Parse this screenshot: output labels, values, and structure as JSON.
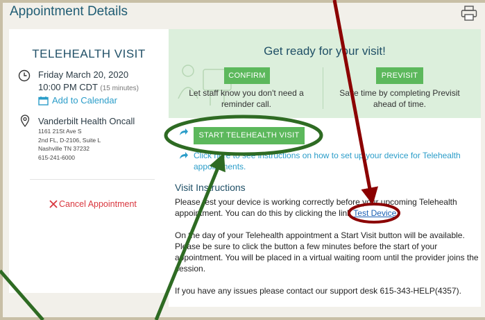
{
  "header": {
    "title": "Appointment Details",
    "print_icon": "printer-icon"
  },
  "appointment": {
    "type": "TELEHEALTH VISIT",
    "date": "Friday March 20, 2020",
    "time": "10:00 PM CDT",
    "duration": "(15 minutes)",
    "add_calendar": "Add to Calendar",
    "location_name": "Vanderbilt Health Oncall",
    "address": [
      "1161 21St Ave S",
      "2nd FL, D-2106, Suite L",
      "Nashville TN 37232",
      "615-241-6000"
    ],
    "cancel": "Cancel Appointment"
  },
  "ready": {
    "title": "Get ready for your visit!",
    "confirm_label": "CONFIRM",
    "confirm_desc": [
      "Let staff know you don't need a",
      "reminder call."
    ],
    "previsit_label": "PREVISIT",
    "previsit_desc": [
      "Save time by completing Previsit",
      "ahead of time."
    ]
  },
  "actions": {
    "start_label": "START TELEHEALTH VISIT",
    "instructions_link": [
      "Click here to see instructions on how to set up your device for Telehealth",
      "appointments."
    ]
  },
  "instructions": {
    "heading": "Visit Instructions",
    "p1": [
      "Please test your device is working correctly before your upcoming Telehealth",
      "appointment.  You can do this by clicking the link"
    ],
    "test_link": "Test Device",
    "p2": [
      "On the day of your Telehealth appointment a Start Visit button will be available.",
      "Please be sure to click the button a few minutes before the start of your",
      "appointment.  You will be placed in a virtual waiting room until the provider joins the",
      "session."
    ],
    "p3": "If you have any issues please contact our support desk 615-343-HELP(4357)."
  },
  "colors": {
    "accent_green": "#5cb85c",
    "arrow_red": "#8b0000",
    "arrow_green": "#2e6b23",
    "cancel_red": "#d9363e",
    "link_blue": "#2b9dc9"
  }
}
